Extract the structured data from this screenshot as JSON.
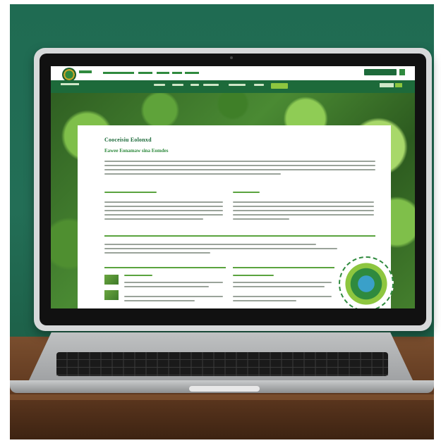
{
  "scene": {
    "description": "",
    "colors": {
      "wall": "#236e56",
      "desk": "#6b4227",
      "brand_green": "#1d6a3a",
      "accent_green": "#8dc63f"
    }
  },
  "website": {
    "nav": {
      "items": [
        "",
        "",
        "",
        "",
        "",
        ""
      ],
      "cta": ""
    },
    "hero": {
      "title": "Cooceisiu Eolonxd",
      "subtitle": "Eawee Eonamaw sina Eomdes"
    },
    "section_left_heading": "",
    "section_right_heading": "",
    "bottom_left_heading": "",
    "bottom_right_heading": ""
  },
  "icons": {
    "logo": "leaf-seal-icon",
    "badge": "eco-badge-icon",
    "left_arrow": "triangle-arrow-icon"
  }
}
